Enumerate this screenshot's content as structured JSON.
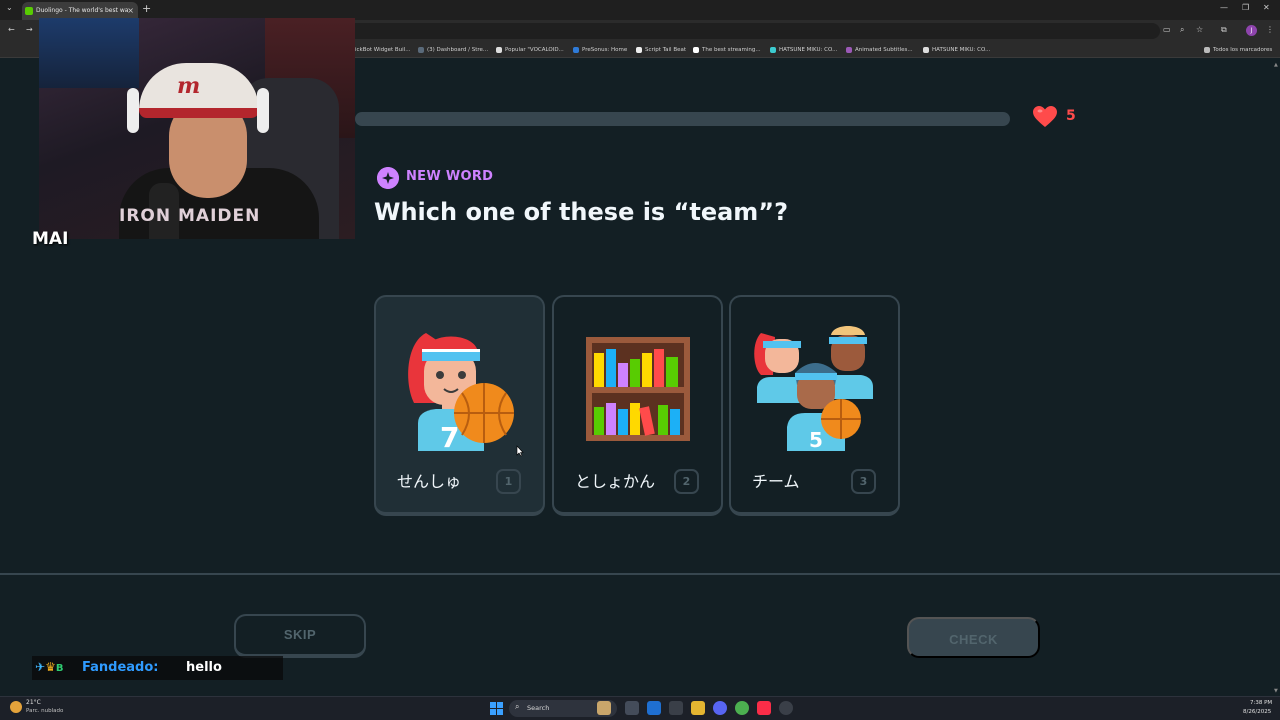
{
  "browser": {
    "tab_title": "Duolingo - The world's best wa",
    "tab_close": "×",
    "new_tab": "+",
    "bookmarks": [
      "ickBot Widget Buil...",
      "(3) Dashboard / Stre...",
      "Popular \"VOCALOID...",
      "PreSonus: Home",
      "Script Tail Beat",
      "The best streaming...",
      "HATSUNE MIKU: CO...",
      "Animated Subtitles...",
      "HATSUNE MIKU: CO..."
    ],
    "all_bookmarks": "Todos los marcadores",
    "profile_initial": "J"
  },
  "lesson": {
    "hearts": "5",
    "tag": "NEW WORD",
    "question": "Which one of these is “team”?",
    "choices": [
      {
        "word": "せんしゅ",
        "key": "1",
        "icon": "athlete-basketball-icon"
      },
      {
        "word": "としょかん",
        "key": "2",
        "icon": "bookshelf-library-icon"
      },
      {
        "word": "チーム",
        "key": "3",
        "icon": "basketball-team-icon"
      }
    ],
    "skip_label": "SKIP",
    "check_label": "CHECK"
  },
  "stream": {
    "streamer_name": "MAI",
    "shirt_text": "IRON MAIDEN",
    "chat_user": "Fandeado:",
    "chat_message": "hello"
  },
  "taskbar": {
    "temperature": "21°C",
    "weather": "Parc. nublado",
    "search_label": "Search",
    "time": "7:38 PM",
    "date": "8/26/2025"
  },
  "colors": {
    "background": "#131f24",
    "border": "#37464f",
    "accent_purple": "#ce82ff",
    "heart_red": "#ff4b4b",
    "text": "#f1f7fb"
  }
}
